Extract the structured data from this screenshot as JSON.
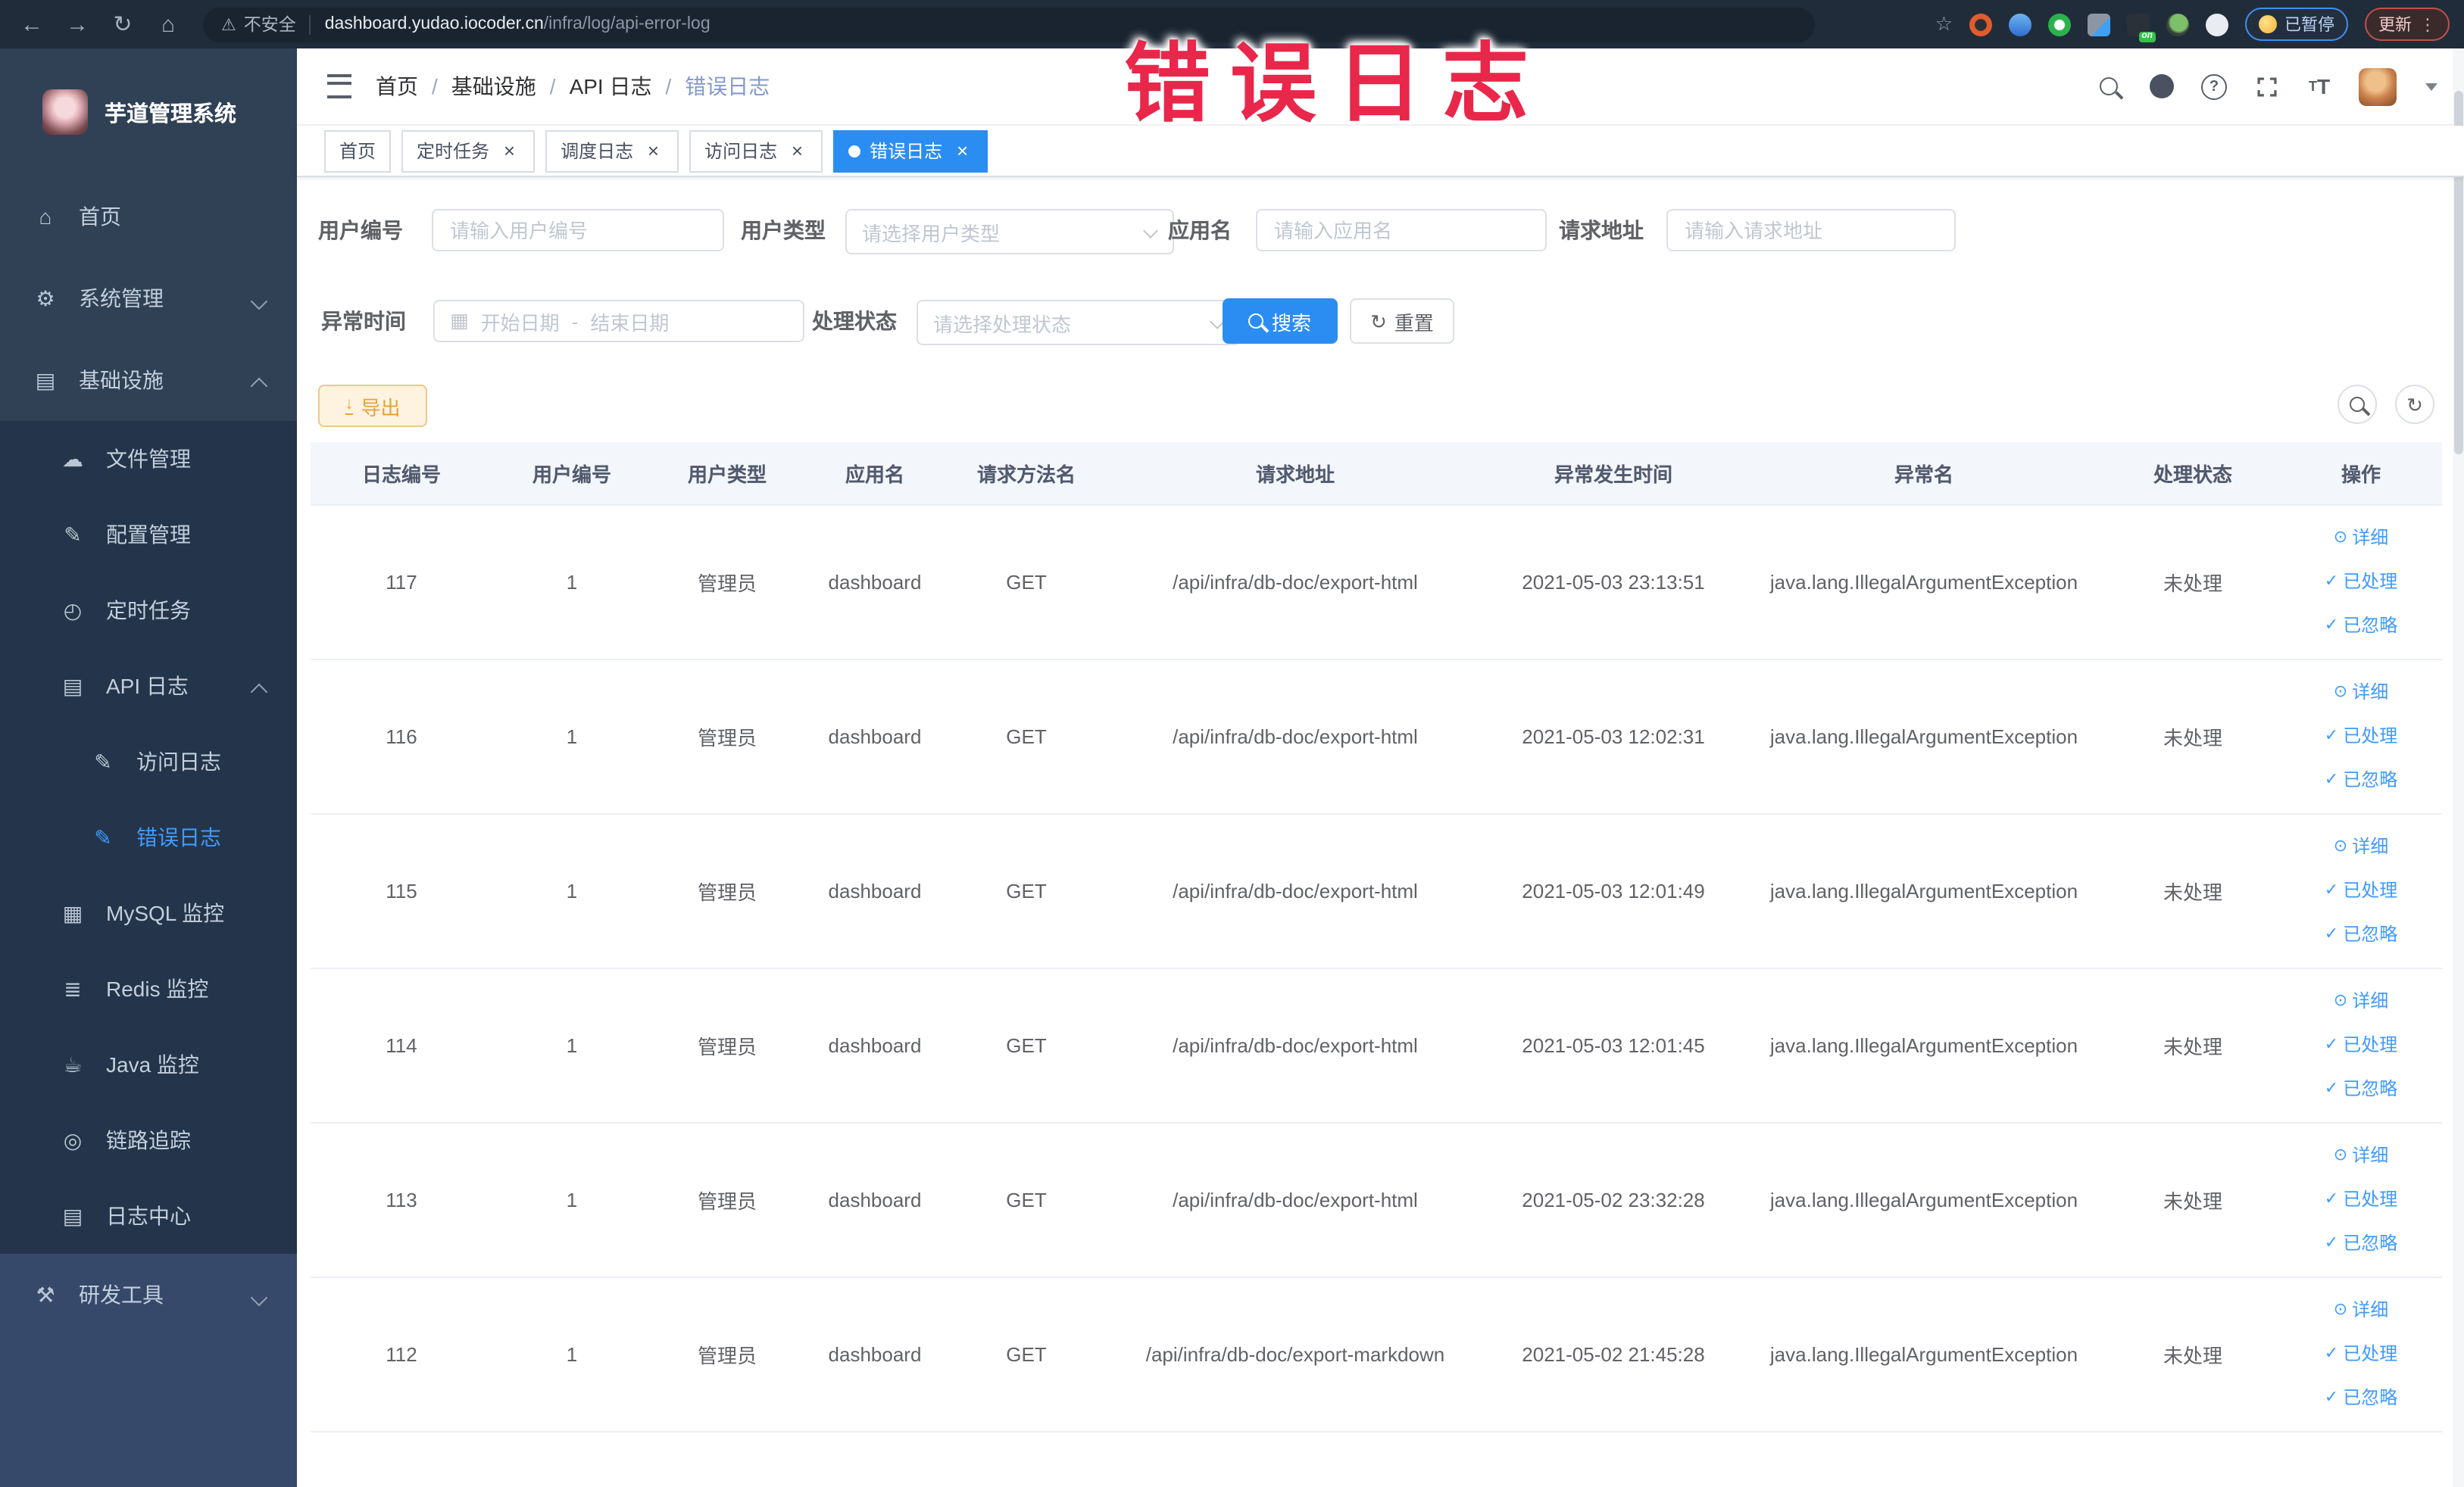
{
  "annotation": {
    "text": "错误日志",
    "color": "#e8274b"
  },
  "colors": {
    "accent": "#409eff",
    "active_tab": "#2b8df2",
    "warning": "#e6a23c",
    "sidebar": "#304156",
    "sidebar_dark": "#24344a",
    "annotation": "#e8274b"
  },
  "browser": {
    "back_icon": "←",
    "forward_icon": "→",
    "reload_icon": "↻",
    "home_icon": "⌂",
    "insecure_icon": "⚠",
    "insecure_label": "不安全",
    "url_host": "dashboard.yudao.iocoder.cn",
    "url_path": "/infra/log/api-error-log",
    "star_icon": "☆",
    "extensions": [
      {
        "name": "ext-orange-icon",
        "color": "radial-gradient(circle,#2b2f36 0 34%,#e25b2b 40%)"
      },
      {
        "name": "ext-blue-shield-icon",
        "color": "linear-gradient(180deg,#6db3f2,#2f6fd0)"
      },
      {
        "name": "ext-green-circle-icon",
        "color": "radial-gradient(circle,#fff 0 30%,#2bb24c 36%)"
      },
      {
        "name": "ext-grid-icon",
        "color": "linear-gradient(135deg,#8b95a3 0 55%,#3fa0f7 60%)",
        "square": true
      },
      {
        "name": "ext-dark-icon",
        "color": "#2a3138",
        "square": true,
        "badge": "on"
      },
      {
        "name": "ext-sprout-icon",
        "color": "radial-gradient(circle at 55% 40%,#7ec06a 0 45%,#35423a 60%)"
      },
      {
        "name": "ext-puzzle-icon",
        "color": "#e9edf2"
      }
    ],
    "paused_chip": "已暂停",
    "update_button": "更新",
    "menu_dots": "⋮"
  },
  "sidebar": {
    "title": "芋道管理系统",
    "items": [
      {
        "name": "sidebar-item-home",
        "label": "首页",
        "icon": "⌂",
        "level": 0
      },
      {
        "name": "sidebar-item-system",
        "label": "系统管理",
        "icon": "⚙",
        "level": 0,
        "chevron": "down"
      },
      {
        "name": "sidebar-item-infra",
        "label": "基础设施",
        "icon": "▤",
        "level": 0,
        "chevron": "up"
      },
      {
        "name": "sidebar-item-files",
        "label": "文件管理",
        "icon": "☁",
        "level": 1
      },
      {
        "name": "sidebar-item-config",
        "label": "配置管理",
        "icon": "✎",
        "level": 1
      },
      {
        "name": "sidebar-item-job",
        "label": "定时任务",
        "icon": "◴",
        "level": 1
      },
      {
        "name": "sidebar-item-api-log",
        "label": "API 日志",
        "icon": "▤",
        "level": 1,
        "chevron": "up"
      },
      {
        "name": "sidebar-item-access-log",
        "label": "访问日志",
        "icon": "✎",
        "level": 2
      },
      {
        "name": "sidebar-item-error-log",
        "label": "错误日志",
        "icon": "✎",
        "level": 2,
        "active": true
      },
      {
        "name": "sidebar-item-mysql",
        "label": "MySQL 监控",
        "icon": "▦",
        "level": 1
      },
      {
        "name": "sidebar-item-redis",
        "label": "Redis 监控",
        "icon": "≣",
        "level": 1
      },
      {
        "name": "sidebar-item-java",
        "label": "Java 监控",
        "icon": "☕",
        "level": 1
      },
      {
        "name": "sidebar-item-tracing",
        "label": "链路追踪",
        "icon": "◎",
        "level": 1
      },
      {
        "name": "sidebar-item-log-center",
        "label": "日志中心",
        "icon": "▤",
        "level": 1
      },
      {
        "name": "sidebar-item-dev-tools",
        "label": "研发工具",
        "icon": "⚒",
        "level": 0,
        "chevron": "down"
      }
    ]
  },
  "header": {
    "breadcrumb": [
      "首页",
      "基础设施",
      "API 日志",
      "错误日志"
    ],
    "separator": "/"
  },
  "tabs": [
    {
      "name": "tab-home",
      "label": "首页"
    },
    {
      "name": "tab-job",
      "label": "定时任务",
      "closable": true
    },
    {
      "name": "tab-job-log",
      "label": "调度日志",
      "closable": true
    },
    {
      "name": "tab-access-log",
      "label": "访问日志",
      "closable": true
    },
    {
      "name": "tab-error-log",
      "label": "错误日志",
      "closable": true,
      "active": true
    }
  ],
  "filters": {
    "user_id": {
      "label": "用户编号",
      "placeholder": "请输入用户编号"
    },
    "user_type": {
      "label": "用户类型",
      "placeholder": "请选择用户类型"
    },
    "app_name": {
      "label": "应用名",
      "placeholder": "请输入应用名"
    },
    "request_url": {
      "label": "请求地址",
      "placeholder": "请输入请求地址"
    },
    "exception_time": {
      "label": "异常时间",
      "calendar_icon": "▦",
      "start_placeholder": "开始日期",
      "separator": "-",
      "end_placeholder": "结束日期"
    },
    "process_status": {
      "label": "处理状态",
      "placeholder": "请选择处理状态"
    },
    "search_button": "搜索",
    "reset_button": "重置",
    "reset_icon": "↻"
  },
  "toolbar": {
    "export_button": "导出",
    "export_icon": "↓",
    "refresh_icon": "↻"
  },
  "table": {
    "columns": [
      "日志编号",
      "用户编号",
      "用户类型",
      "应用名",
      "请求方法名",
      "请求地址",
      "异常发生时间",
      "异常名",
      "处理状态",
      "操作"
    ],
    "row_actions": [
      {
        "name": "action-detail",
        "label": "详细",
        "icon": "⊙"
      },
      {
        "name": "action-processed",
        "label": "已处理",
        "icon": "✓"
      },
      {
        "name": "action-ignored",
        "label": "已忽略",
        "icon": "✓"
      }
    ],
    "rows": [
      {
        "id": "117",
        "user_id": "1",
        "user_type": "管理员",
        "app_name": "dashboard",
        "method": "GET",
        "url": "/api/infra/db-doc/export-html",
        "time": "2021-05-03 23:13:51",
        "exception": "java.lang.IllegalArgumentException",
        "status": "未处理"
      },
      {
        "id": "116",
        "user_id": "1",
        "user_type": "管理员",
        "app_name": "dashboard",
        "method": "GET",
        "url": "/api/infra/db-doc/export-html",
        "time": "2021-05-03 12:02:31",
        "exception": "java.lang.IllegalArgumentException",
        "status": "未处理"
      },
      {
        "id": "115",
        "user_id": "1",
        "user_type": "管理员",
        "app_name": "dashboard",
        "method": "GET",
        "url": "/api/infra/db-doc/export-html",
        "time": "2021-05-03 12:01:49",
        "exception": "java.lang.IllegalArgumentException",
        "status": "未处理"
      },
      {
        "id": "114",
        "user_id": "1",
        "user_type": "管理员",
        "app_name": "dashboard",
        "method": "GET",
        "url": "/api/infra/db-doc/export-html",
        "time": "2021-05-03 12:01:45",
        "exception": "java.lang.IllegalArgumentException",
        "status": "未处理"
      },
      {
        "id": "113",
        "user_id": "1",
        "user_type": "管理员",
        "app_name": "dashboard",
        "method": "GET",
        "url": "/api/infra/db-doc/export-html",
        "time": "2021-05-02 23:32:28",
        "exception": "java.lang.IllegalArgumentException",
        "status": "未处理"
      },
      {
        "id": "112",
        "user_id": "1",
        "user_type": "管理员",
        "app_name": "dashboard",
        "method": "GET",
        "url": "/api/infra/db-doc/export-markdown",
        "time": "2021-05-02 21:45:28",
        "exception": "java.lang.IllegalArgumentException",
        "status": "未处理"
      }
    ]
  }
}
